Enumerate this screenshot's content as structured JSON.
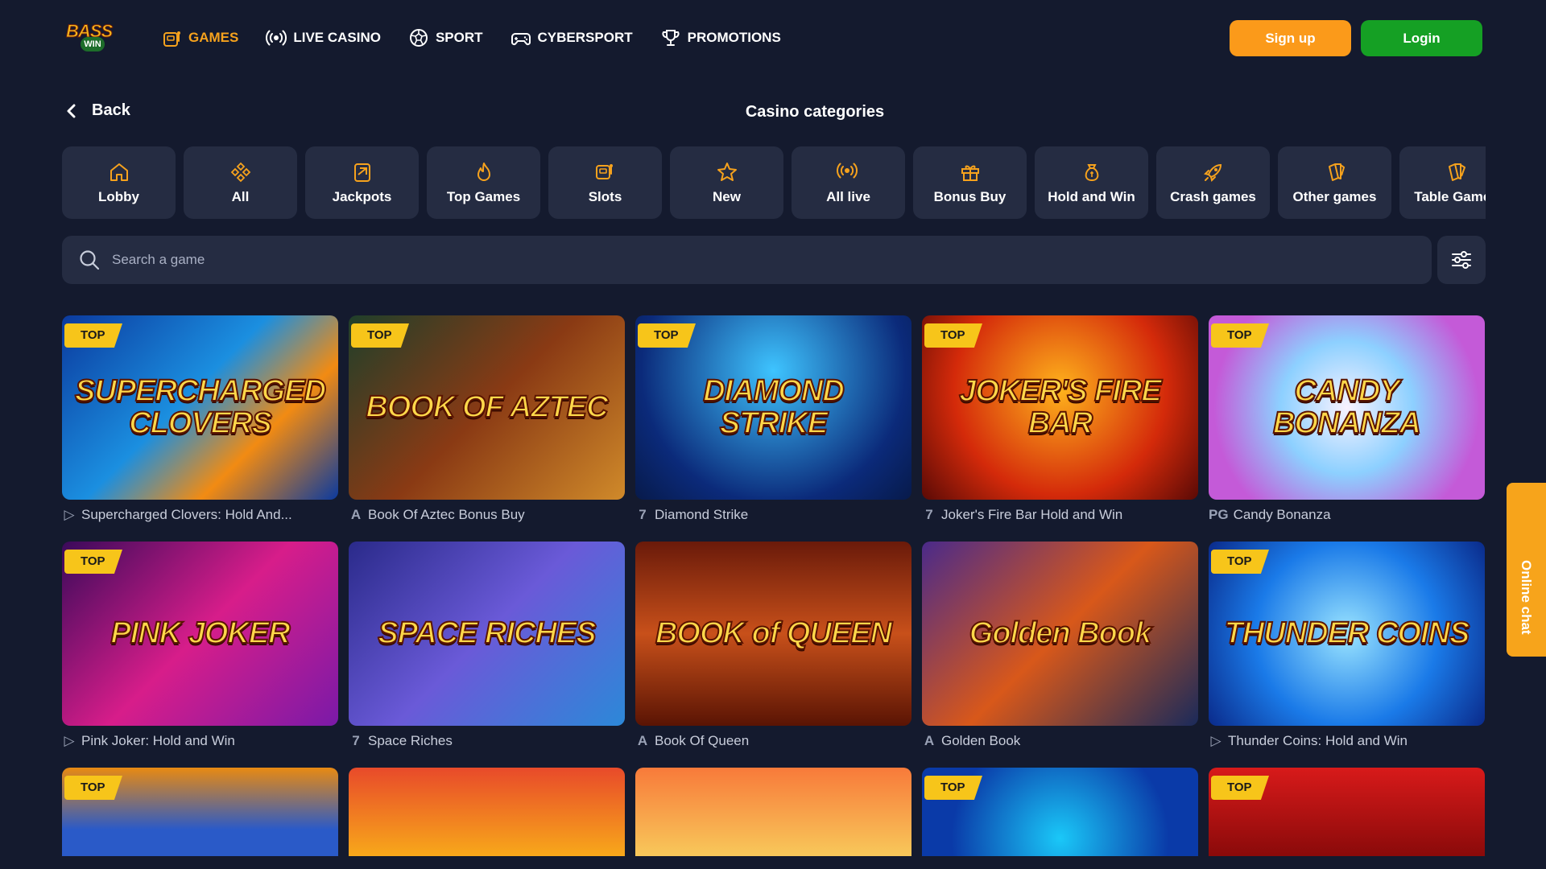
{
  "brand": {
    "logo_top": "BASS",
    "logo_bottom": "WIN"
  },
  "nav": [
    {
      "label": "GAMES",
      "icon": "slot-machine-icon",
      "active": true
    },
    {
      "label": "LIVE CASINO",
      "icon": "broadcast-icon",
      "active": false
    },
    {
      "label": "SPORT",
      "icon": "soccer-ball-icon",
      "active": false
    },
    {
      "label": "CYBERSPORT",
      "icon": "gamepad-icon",
      "active": false
    },
    {
      "label": "PROMOTIONS",
      "icon": "trophy-icon",
      "active": false
    }
  ],
  "auth": {
    "signup_label": "Sign up",
    "login_label": "Login"
  },
  "back_label": "Back",
  "page_title": "Casino categories",
  "categories": [
    {
      "label": "Lobby",
      "icon": "home-icon"
    },
    {
      "label": "All",
      "icon": "diamonds-icon"
    },
    {
      "label": "Jackpots",
      "icon": "jackpot-icon"
    },
    {
      "label": "Top Games",
      "icon": "flame-icon"
    },
    {
      "label": "Slots",
      "icon": "slot-machine-icon"
    },
    {
      "label": "New",
      "icon": "star-icon"
    },
    {
      "label": "All live",
      "icon": "broadcast-icon"
    },
    {
      "label": "Bonus Buy",
      "icon": "gift-icon"
    },
    {
      "label": "Hold and Win",
      "icon": "money-bag-icon"
    },
    {
      "label": "Crash games",
      "icon": "rocket-icon"
    },
    {
      "label": "Other games",
      "icon": "cards-fan-icon"
    },
    {
      "label": "Table Games",
      "icon": "table-cards-icon"
    }
  ],
  "search": {
    "placeholder": "Search a game"
  },
  "top_badge": "TOP",
  "games": [
    {
      "title": "Supercharged Clovers: Hold And...",
      "art": "SUPERCHARGED CLOVERS",
      "provider": "▷",
      "top": true,
      "bg": "linear-gradient(135deg,#0b3a9e,#1b8fe0 45%,#f28b12 70%,#0b3a9e)"
    },
    {
      "title": "Book Of Aztec Bonus Buy",
      "art": "BOOK OF AZTEC",
      "provider": "A",
      "top": true,
      "bg": "linear-gradient(135deg,#1f3f2a,#8a3a14 50%,#d08a2a)"
    },
    {
      "title": "Diamond Strike",
      "art": "DIAMOND STRIKE",
      "provider": "7",
      "top": true,
      "bg": "radial-gradient(circle at 50% 30%,#3ec4ff,#0b2a7a 70%,#071a4a)"
    },
    {
      "title": "Joker's Fire Bar Hold and Win",
      "art": "JOKER'S FIRE BAR",
      "provider": "7",
      "top": true,
      "bg": "radial-gradient(circle at 50% 40%,#ffb31c,#d42a0a 60%,#5a0a06)"
    },
    {
      "title": "Candy Bonanza",
      "art": "CANDY BONANZA",
      "provider": "PG",
      "top": true,
      "bg": "radial-gradient(circle at 50% 50%,#f8f2ff,#8dd0ff 40%,#c45ad8 80%)"
    },
    {
      "title": "Pink Joker: Hold and Win",
      "art": "PINK JOKER",
      "provider": "▷",
      "top": true,
      "bg": "linear-gradient(135deg,#3a0a5a,#d71d8a 50%,#7a1aa8)"
    },
    {
      "title": "Space Riches",
      "art": "SPACE RICHES",
      "provider": "7",
      "top": false,
      "bg": "linear-gradient(135deg,#2a2a8a,#6a5ad8 50%,#2c88d8)"
    },
    {
      "title": "Book Of Queen",
      "art": "BOOK of QUEEN",
      "provider": "A",
      "top": false,
      "bg": "linear-gradient(180deg,#6a1a0a,#c8501a 50%,#5a1404)"
    },
    {
      "title": "Golden Book",
      "art": "Golden Book",
      "provider": "A",
      "top": false,
      "bg": "linear-gradient(135deg,#4a2a8a,#d8581a 50%,#1a2a5a)"
    },
    {
      "title": "Thunder Coins: Hold and Win",
      "art": "THUNDER COINS",
      "provider": "▷",
      "top": true,
      "bg": "radial-gradient(circle at 50% 50%,#9ae4ff,#1a7ae8 55%,#0a2a8a)"
    },
    {
      "title": "",
      "art": "",
      "provider": "",
      "top": true,
      "bg": "linear-gradient(180deg,#e88a12,#2a5ac8 70%)"
    },
    {
      "title": "",
      "art": "",
      "provider": "",
      "top": false,
      "bg": "linear-gradient(180deg,#e84a2a,#f8a81a)"
    },
    {
      "title": "",
      "art": "",
      "provider": "",
      "top": false,
      "bg": "linear-gradient(180deg,#f87a3a,#f8c85a)"
    },
    {
      "title": "",
      "art": "",
      "provider": "",
      "top": true,
      "bg": "radial-gradient(circle at 50% 80%,#1ac8f8,#0a3aa8 70%)"
    },
    {
      "title": "",
      "art": "",
      "provider": "",
      "top": true,
      "bg": "linear-gradient(180deg,#d81a1a,#8a0a0a)"
    }
  ],
  "chat_label": "Online chat",
  "colors": {
    "background": "#141a2e",
    "panel": "#252c42",
    "accent": "#f6a21d",
    "login": "#15a024",
    "badge": "#f7c51a"
  }
}
